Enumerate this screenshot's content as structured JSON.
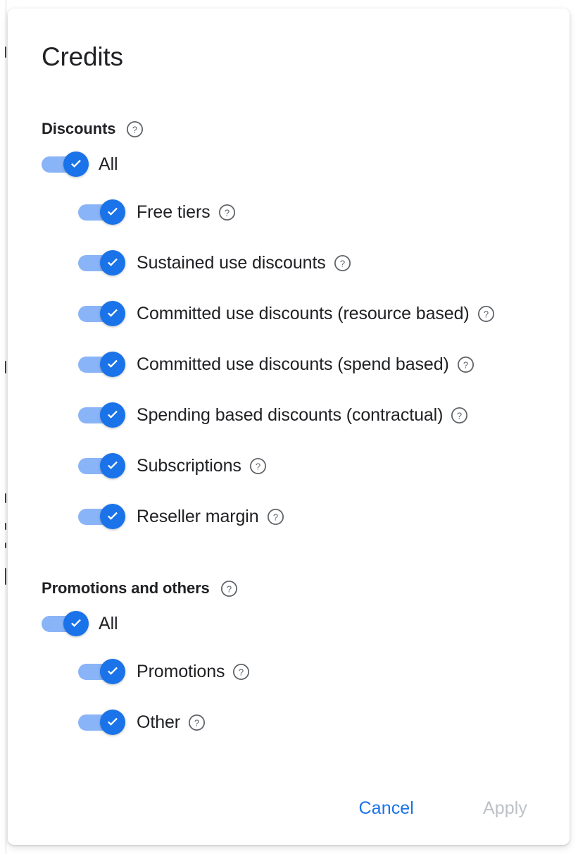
{
  "dialog": {
    "title": "Credits",
    "sections": [
      {
        "id": "discounts",
        "header": "Discounts",
        "help_icon": "help-outline-icon",
        "all": {
          "label": "All",
          "checked": true
        },
        "items": [
          {
            "label": "Free tiers",
            "checked": true,
            "help_icon": "help-outline-icon"
          },
          {
            "label": "Sustained use discounts",
            "checked": true,
            "help_icon": "help-outline-icon"
          },
          {
            "label": "Committed use discounts (resource based)",
            "checked": true,
            "help_icon": "help-outline-icon"
          },
          {
            "label": "Committed use discounts (spend based)",
            "checked": true,
            "help_icon": "help-outline-icon"
          },
          {
            "label": "Spending based discounts (contractual)",
            "checked": true,
            "help_icon": "help-outline-icon"
          },
          {
            "label": "Subscriptions",
            "checked": true,
            "help_icon": "help-outline-icon"
          },
          {
            "label": "Reseller margin",
            "checked": true,
            "help_icon": "help-outline-icon"
          }
        ]
      },
      {
        "id": "promotions-and-others",
        "header": "Promotions and others",
        "help_icon": "help-outline-icon",
        "all": {
          "label": "All",
          "checked": true
        },
        "items": [
          {
            "label": "Promotions",
            "checked": true,
            "help_icon": "help-outline-icon"
          },
          {
            "label": "Other",
            "checked": true,
            "help_icon": "help-outline-icon"
          }
        ]
      }
    ],
    "footer": {
      "cancel_label": "Cancel",
      "apply_label": "Apply",
      "apply_disabled": true
    }
  },
  "colors": {
    "accent": "#1a73e8",
    "toggle_track": "#8ab4f8",
    "text_primary": "#202124",
    "text_disabled": "#bdc1c6",
    "icon_grey": "#5f6368",
    "surface": "#ffffff"
  }
}
